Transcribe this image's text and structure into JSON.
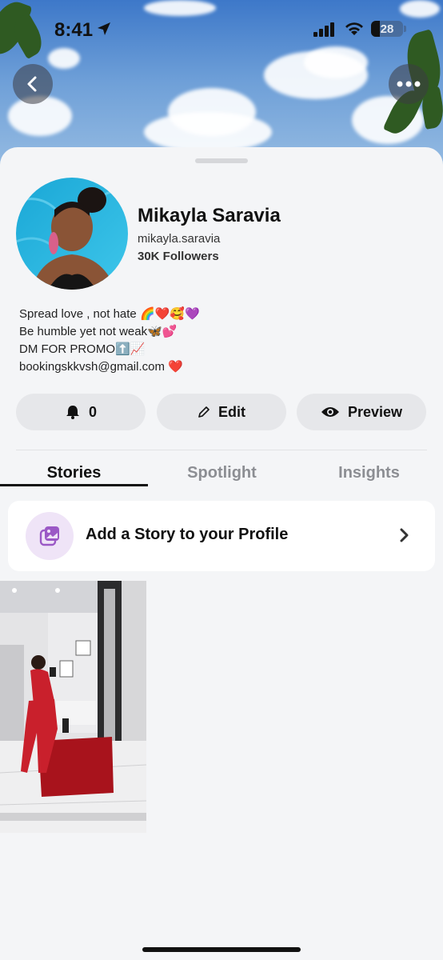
{
  "status_bar": {
    "time": "8:41",
    "battery": "28",
    "battery_level": 0.28
  },
  "profile": {
    "display_name": "Mikayla Saravia",
    "username": "mikayla.saravia",
    "followers": "30K Followers",
    "bio": [
      "Spread love , not hate 🌈❤️🥰💜",
      "Be humble yet not weak🦋💕",
      "DM FOR PROMO⬆️📈",
      "bookingskkvsh@gmail.com ❤️"
    ]
  },
  "actions": {
    "notifications_count": "0",
    "edit_label": "Edit",
    "preview_label": "Preview"
  },
  "tabs": [
    {
      "label": "Stories",
      "active": true
    },
    {
      "label": "Spotlight",
      "active": false
    },
    {
      "label": "Insights",
      "active": false
    }
  ],
  "story_card": {
    "label": "Add a Story to your Profile"
  },
  "colors": {
    "sheet_background": "#f4f5f7",
    "button_background": "#e6e7ea",
    "story_icon_background": "#efe4f7",
    "story_icon_accent": "#9b59c6",
    "inactive_tab": "#8c8e93"
  },
  "icons": {
    "back": "chevron-left-icon",
    "more": "more-dots-icon",
    "notifications": "bell-icon",
    "edit": "pencil-icon",
    "preview": "eye-icon",
    "add_story": "add-story-icon",
    "chevron": "chevron-right-icon",
    "location_arrow": "location-arrow-icon",
    "signal": "cellular-signal-icon",
    "wifi": "wifi-icon"
  }
}
